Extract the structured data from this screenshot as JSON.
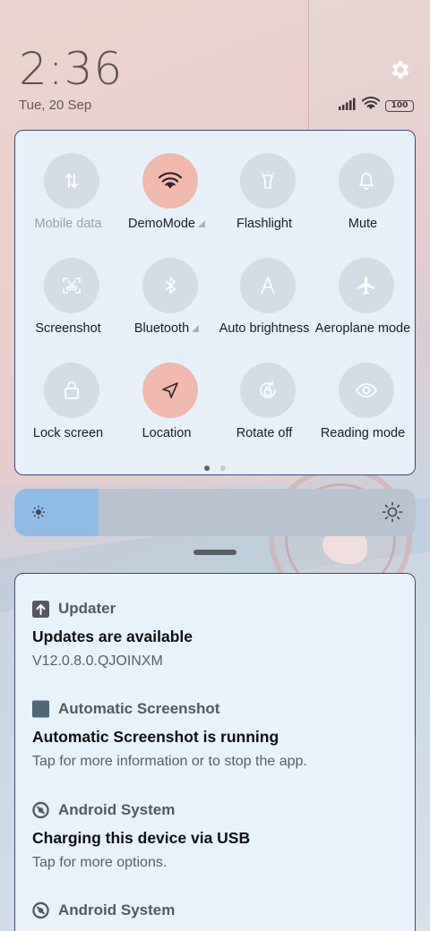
{
  "status": {
    "time": "2:36",
    "date": "Tue, 20 Sep",
    "battery": "100"
  },
  "quick_settings": {
    "tiles": [
      {
        "label": "Mobile data",
        "icon": "mobile-data-icon",
        "active": false,
        "disabled": true,
        "expandable": false
      },
      {
        "label": "DemoMode",
        "icon": "wifi-icon",
        "active": true,
        "disabled": false,
        "expandable": true
      },
      {
        "label": "Flashlight",
        "icon": "flashlight-icon",
        "active": false,
        "disabled": false,
        "expandable": false
      },
      {
        "label": "Mute",
        "icon": "bell-icon",
        "active": false,
        "disabled": false,
        "expandable": false
      },
      {
        "label": "Screenshot",
        "icon": "screenshot-icon",
        "active": false,
        "disabled": false,
        "expandable": false
      },
      {
        "label": "Bluetooth",
        "icon": "bluetooth-icon",
        "active": false,
        "disabled": false,
        "expandable": true
      },
      {
        "label": "Auto brightness",
        "icon": "auto-brightness-icon",
        "active": false,
        "disabled": false,
        "expandable": false
      },
      {
        "label": "Aeroplane mode",
        "icon": "airplane-icon",
        "active": false,
        "disabled": false,
        "expandable": false
      },
      {
        "label": "Lock screen",
        "icon": "lock-icon",
        "active": false,
        "disabled": false,
        "expandable": false
      },
      {
        "label": "Location",
        "icon": "location-icon",
        "active": true,
        "disabled": false,
        "expandable": false
      },
      {
        "label": "Rotate off",
        "icon": "rotate-icon",
        "active": false,
        "disabled": false,
        "expandable": false
      },
      {
        "label": "Reading mode",
        "icon": "eye-icon",
        "active": false,
        "disabled": false,
        "expandable": false
      }
    ],
    "page_count": 2,
    "current_page": 1
  },
  "brightness": {
    "level": 0.21
  },
  "notifications": [
    {
      "app": "Updater",
      "icon": "update-arrow-icon",
      "title": "Updates are available",
      "body": "V12.0.8.0.QJOINXM"
    },
    {
      "app": "Automatic Screenshot",
      "icon": "app-square-icon",
      "title": "Automatic Screenshot is running",
      "body": "Tap for more information or to stop the app."
    },
    {
      "app": "Android System",
      "icon": "android-system-icon",
      "title": "Charging this device via USB",
      "body": "Tap for more options."
    },
    {
      "app": "Android System",
      "icon": "android-system-icon",
      "title": "",
      "body": ""
    }
  ],
  "colors": {
    "active_tile": "#efb9ad",
    "inactive_tile": "#d4dde6",
    "panel_border": "#3f4a78",
    "slider_fill": "#8fbce4"
  }
}
